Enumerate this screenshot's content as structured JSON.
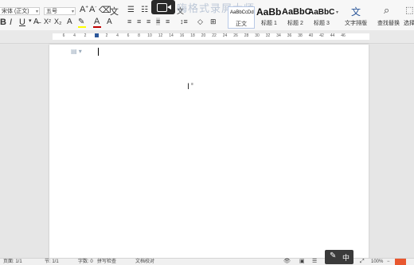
{
  "ribbon": {
    "font_name": "宋体 (正文)",
    "font_size": "五号",
    "styles": [
      {
        "sample": "AaBbCcDd",
        "label": "正文"
      },
      {
        "sample": "AaBb",
        "label": "标题 1"
      },
      {
        "sample": "AaBbC",
        "label": "标题 2"
      },
      {
        "sample": "AaBbC",
        "label": "标题 3"
      }
    ],
    "text_layout_label": "文字排版",
    "find_replace_label": "查找替换",
    "select_label": "选择"
  },
  "overlay": {
    "watermark_text": "嗨格式录屏大师"
  },
  "ruler": {
    "ticks": [
      "6",
      "4",
      "2",
      "",
      "2",
      "4",
      "6",
      "8",
      "10",
      "12",
      "14",
      "16",
      "18",
      "20",
      "22",
      "24",
      "26",
      "28",
      "30",
      "32",
      "34",
      "36",
      "38",
      "40",
      "42",
      "44",
      "46"
    ]
  },
  "status": {
    "page_info": "页面: 1/1",
    "section": "节: 1/1",
    "word_count": "字数: 0",
    "spell_check": "拼写检查",
    "doc_check": "文档校对",
    "zoom": "100%"
  },
  "ime": {
    "mode": "中"
  },
  "colors": {
    "font_color": "#c00000",
    "highlight": "#ffff00",
    "accent": "#2b579a"
  }
}
